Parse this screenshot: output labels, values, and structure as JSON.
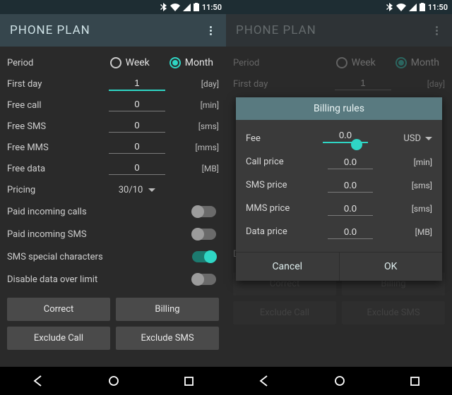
{
  "status": {
    "time": "11:50"
  },
  "title": "PHONE PLAN",
  "period": {
    "label": "Period",
    "week": "Week",
    "month": "Month",
    "selected": "month"
  },
  "rows": {
    "first_day": {
      "label": "First day",
      "value": "1",
      "unit": "[day]"
    },
    "free_call": {
      "label": "Free call",
      "value": "0",
      "unit": "[min]"
    },
    "free_sms": {
      "label": "Free SMS",
      "value": "0",
      "unit": "[sms]"
    },
    "free_mms": {
      "label": "Free MMS",
      "value": "0",
      "unit": "[mms]"
    },
    "free_data": {
      "label": "Free data",
      "value": "0",
      "unit": "[MB]"
    }
  },
  "pricing": {
    "label": "Pricing",
    "value": "30/10"
  },
  "switches": {
    "paid_incoming_calls": {
      "label": "Paid incoming calls",
      "on": false
    },
    "paid_incoming_sms": {
      "label": "Paid incoming SMS",
      "on": false
    },
    "sms_special_chars": {
      "label": "SMS special characters",
      "on": true
    },
    "disable_data_limit": {
      "label": "Disable data over limit",
      "on": false
    }
  },
  "buttons": {
    "correct": "Correct",
    "billing": "Billing",
    "exclude_call": "Exclude Call",
    "exclude_sms": "Exclude SMS"
  },
  "dialog": {
    "title": "Billing rules",
    "fee": {
      "label": "Fee",
      "value": "0.0",
      "currency": "USD"
    },
    "call_price": {
      "label": "Call price",
      "value": "0.0",
      "unit": "[min]"
    },
    "sms_price": {
      "label": "SMS price",
      "value": "0.0",
      "unit": "[sms]"
    },
    "mms_price": {
      "label": "MMS price",
      "value": "0.0",
      "unit": "[sms]"
    },
    "data_price": {
      "label": "Data price",
      "value": "0.0",
      "unit": "[MB]"
    },
    "cancel": "Cancel",
    "ok": "OK"
  }
}
